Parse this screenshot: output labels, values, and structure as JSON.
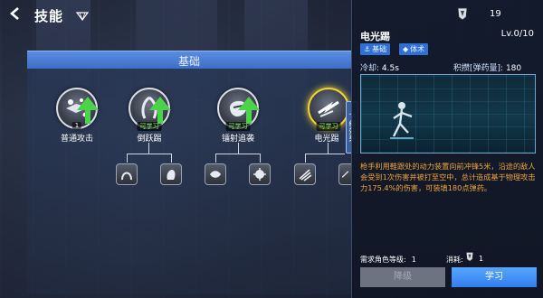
{
  "header": {
    "title": "技能"
  },
  "section": {
    "title": "基础"
  },
  "skills": [
    {
      "name": "普通攻击",
      "badge": "1"
    },
    {
      "name": "倒跃踢",
      "badge": "可学习"
    },
    {
      "name": "镭射追袭",
      "badge": "可学习"
    },
    {
      "name": "电光踢",
      "badge": "可学习"
    }
  ],
  "next_level_tab": "下级效果",
  "detail": {
    "currency_count": "19",
    "skill_title": "电光踢",
    "level": "Lv.0/10",
    "tags": [
      "基础",
      "体术"
    ],
    "cooldown_label": "冷却:",
    "cooldown_value": "4.5s",
    "accum_label": "积攒[弹药量]:",
    "accum_value": "180",
    "description": "枪手利用鞋跟处的动力装置向前冲锋5米，沿途的敌人会受到1次伤害并被打至空中，总计造成基于物理攻击力175.4%的伤害，可装填180点弹药。",
    "requirement_label": "需求角色等级:",
    "requirement_value": "1",
    "cost_label": "消耗:",
    "cost_value": "1",
    "downgrade_label": "降级",
    "learn_label": "学习"
  },
  "colors": {
    "accent": "#2f7ff0",
    "description": "#f0a33a",
    "learnable": "#7dff6a",
    "selected_ring": "#f2d534"
  },
  "icons": {
    "back": "chevron-left-icon",
    "currency": "skill-point-icon",
    "skill_nodes": [
      "gun-burst-icon",
      "kick-flip-icon",
      "laser-beast-icon",
      "lightning-kick-icon"
    ],
    "sub_nodes": [
      "arch-icon",
      "hand-icon",
      "dash-icon",
      "burst-icon",
      "swoosh-icon",
      "partial-icon"
    ]
  }
}
